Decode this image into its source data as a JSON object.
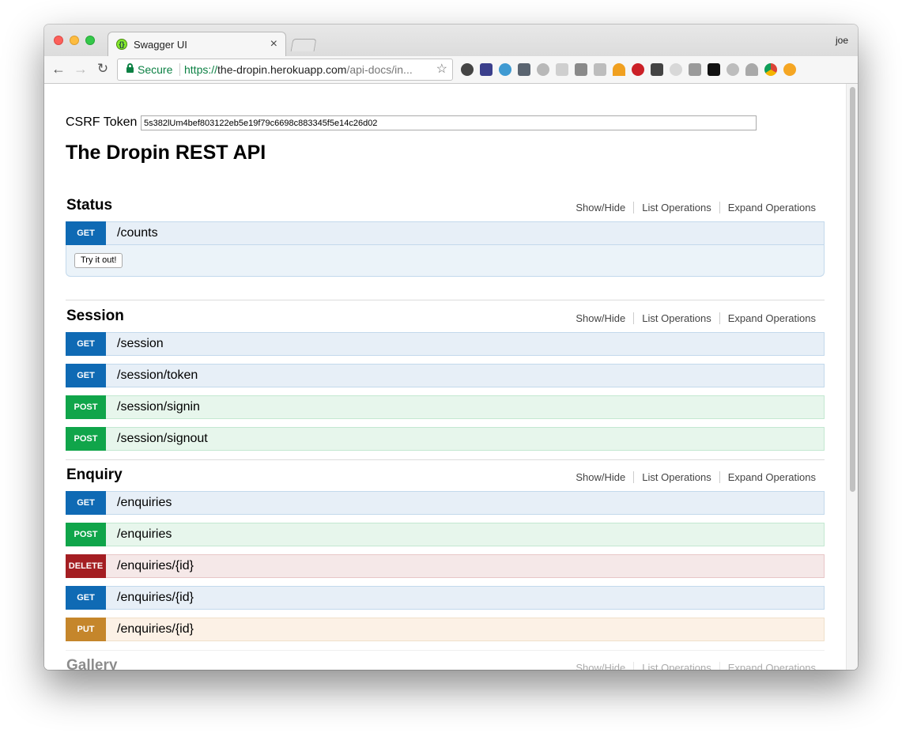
{
  "browser": {
    "tab_title": "Swagger UI",
    "tab_close": "×",
    "favicon": "swagger-logo",
    "profile_name": "joe",
    "secure_label": "Secure",
    "url_scheme": "https://",
    "url_domain": "the-dropin.herokuapp.com",
    "url_path": "/api-docs/in...",
    "nav": {
      "back": "←",
      "forward": "→",
      "reload": "↻"
    },
    "star": "☆"
  },
  "page": {
    "csrf_label": "CSRF Token",
    "csrf_value": "5s382lUm4bef803122eb5e19f79c6698c883345f5e14c26d02",
    "title": "The Dropin REST API",
    "resource_links": {
      "show_hide": "Show/Hide",
      "list": "List Operations",
      "expand": "Expand Operations"
    },
    "try_button": "Try it out!",
    "resources": [
      {
        "name": "Status",
        "operations": [
          {
            "method": "GET",
            "path": "/counts"
          }
        ]
      },
      {
        "name": "Session",
        "operations": [
          {
            "method": "GET",
            "path": "/session"
          },
          {
            "method": "GET",
            "path": "/session/token"
          },
          {
            "method": "POST",
            "path": "/session/signin"
          },
          {
            "method": "POST",
            "path": "/session/signout"
          }
        ]
      },
      {
        "name": "Enquiry",
        "operations": [
          {
            "method": "GET",
            "path": "/enquiries"
          },
          {
            "method": "POST",
            "path": "/enquiries"
          },
          {
            "method": "DELETE",
            "path": "/enquiries/{id}"
          },
          {
            "method": "GET",
            "path": "/enquiries/{id}"
          },
          {
            "method": "PUT",
            "path": "/enquiries/{id}"
          }
        ]
      },
      {
        "name": "Gallery",
        "operations": []
      }
    ]
  },
  "colors": {
    "get": "#0f6ab4",
    "post": "#10a54a",
    "delete": "#a41e22",
    "put": "#c5862b",
    "secure": "#0b8043"
  }
}
